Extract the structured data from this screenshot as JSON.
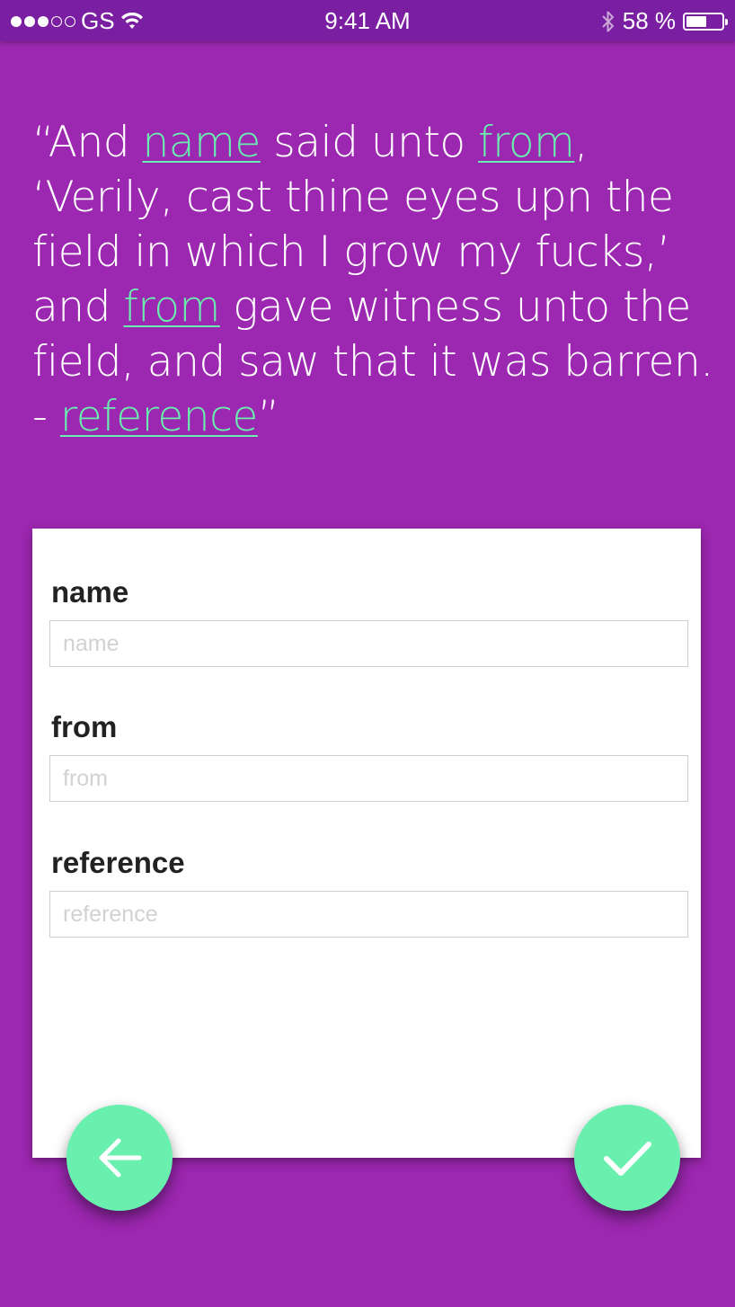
{
  "status_bar": {
    "carrier": "GS",
    "time": "9:41 AM",
    "battery_percent": "58 %",
    "battery_level": 0.58,
    "signal_bars_filled": 3,
    "signal_bars_total": 5
  },
  "quote": {
    "segments": [
      {
        "text": "“And ",
        "is_var": false
      },
      {
        "text": "name",
        "is_var": true
      },
      {
        "text": " said unto ",
        "is_var": false
      },
      {
        "text": "from",
        "is_var": true
      },
      {
        "text": ", ‘Verily, cast thine eyes upn the field in which I grow my fucks,’ and ",
        "is_var": false
      },
      {
        "text": "from",
        "is_var": true
      },
      {
        "text": " gave witness unto the field, and saw that it was barren. - ",
        "is_var": false
      },
      {
        "text": "reference",
        "is_var": true
      },
      {
        "text": "”",
        "is_var": false
      }
    ]
  },
  "form": {
    "fields": [
      {
        "label": "name",
        "placeholder": "name",
        "value": ""
      },
      {
        "label": "from",
        "placeholder": "from",
        "value": ""
      },
      {
        "label": "reference",
        "placeholder": "reference",
        "value": ""
      }
    ]
  },
  "icons": {
    "back": "arrow-left-icon",
    "confirm": "check-icon",
    "wifi": "wifi-icon",
    "bluetooth": "bluetooth-icon",
    "battery": "battery-icon"
  },
  "colors": {
    "background": "#9c27b0",
    "status_bar": "#7b1fa2",
    "accent": "#69f0ae"
  }
}
